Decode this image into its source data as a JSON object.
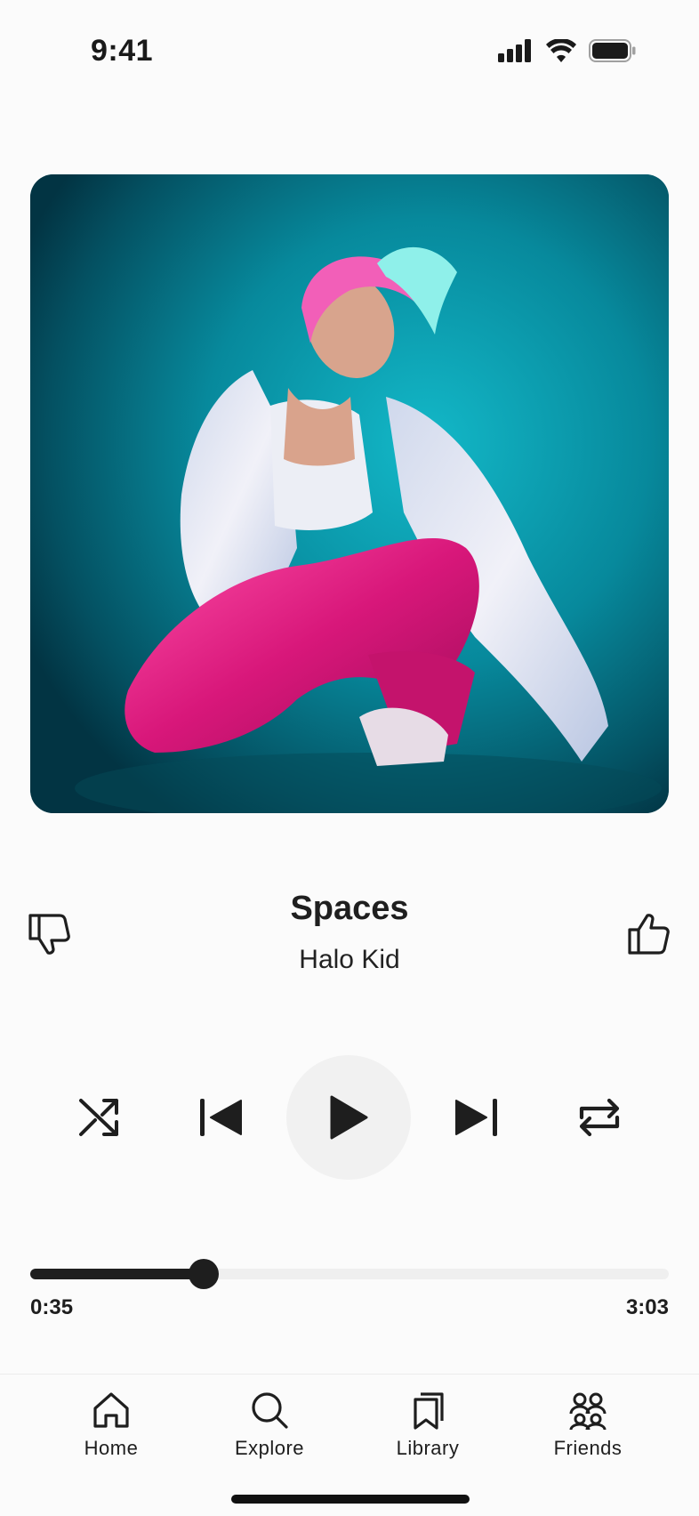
{
  "status_bar": {
    "time": "9:41",
    "icons": [
      "cellular-signal-icon",
      "wifi-icon",
      "battery-icon"
    ]
  },
  "artwork": {
    "description_icon": "album-art-image",
    "colors": {
      "background": "#077f92",
      "pants": "#e0217a",
      "jacket": "#e6e9f2",
      "hair_pink": "#f25fb8",
      "hair_teal": "#8ff0ea"
    }
  },
  "track": {
    "title": "Spaces",
    "artist": "Halo Kid"
  },
  "actions": {
    "dislike_icon": "thumbs-down-icon",
    "like_icon": "thumbs-up-icon"
  },
  "controls": {
    "shuffle_icon": "shuffle-icon",
    "previous_icon": "skip-previous-icon",
    "play_icon": "play-icon",
    "next_icon": "skip-next-icon",
    "repeat_icon": "repeat-icon"
  },
  "progress": {
    "elapsed": "0:35",
    "total": "3:03",
    "fraction": 0.272
  },
  "tabs": [
    {
      "label": "Home",
      "icon": "home-icon"
    },
    {
      "label": "Explore",
      "icon": "search-icon"
    },
    {
      "label": "Library",
      "icon": "bookmark-icon"
    },
    {
      "label": "Friends",
      "icon": "friends-icon"
    }
  ],
  "colors": {
    "background": "#fbfbfb",
    "accent": "#1e1e1e",
    "track_bg": "#efefef",
    "play_bg": "#f1f1f1"
  }
}
